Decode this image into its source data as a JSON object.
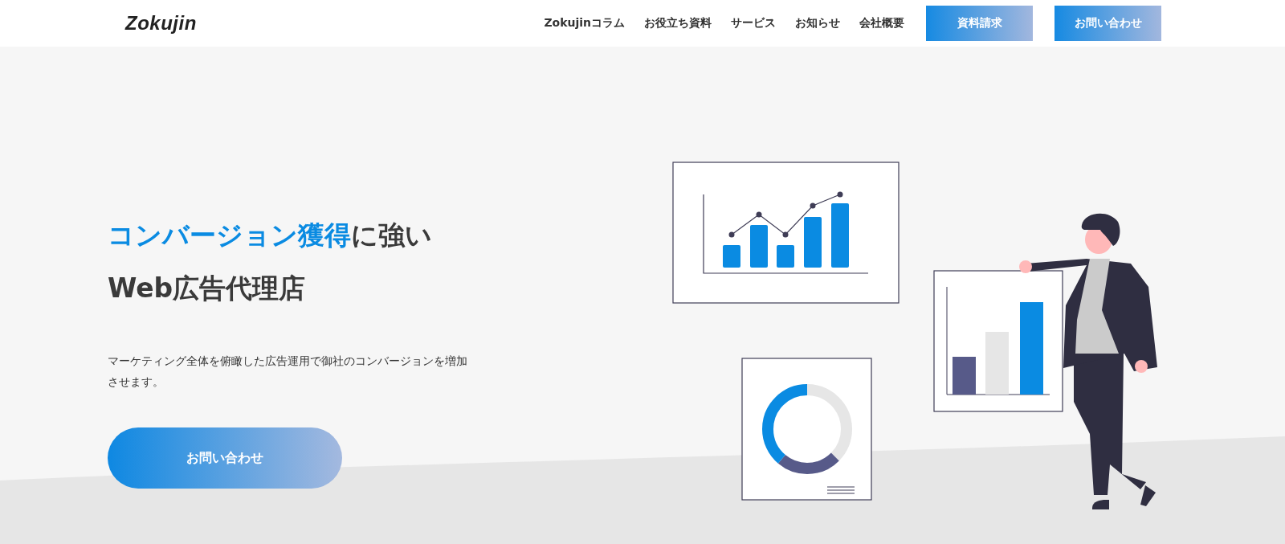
{
  "header": {
    "logo": "Zokujin",
    "nav": [
      "Zokujinコラム",
      "お役立ち資料",
      "サービス",
      "お知らせ",
      "会社概要"
    ],
    "buttons": [
      "資料請求",
      "お問い合わせ"
    ]
  },
  "hero": {
    "headline": {
      "highlight": "コンバージョン獲得",
      "rest": "に強い"
    },
    "headline_line2": "Web広告代理店",
    "description": "マーケティング全体を俯瞰した広告運用で御社のコンバージョンを増加させます。",
    "cta": "お問い合わせ"
  }
}
